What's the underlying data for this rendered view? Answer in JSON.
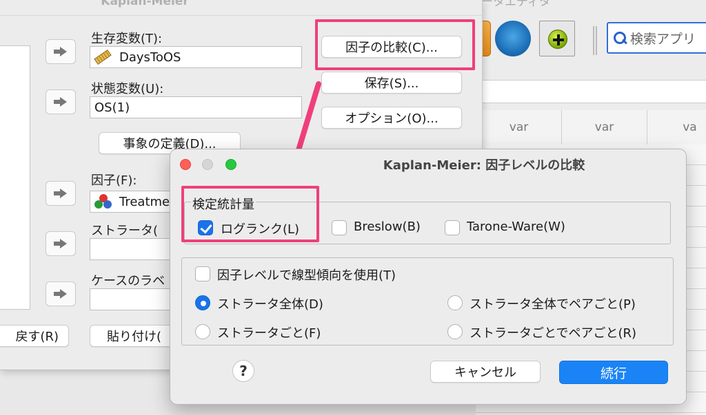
{
  "background_app": {
    "title": "ータエディタ",
    "search_placeholder": "検索アプリ",
    "column_headers": [
      "",
      "var",
      "var",
      "va"
    ]
  },
  "main_dialog": {
    "title": "Kaplan-Meier",
    "survival_label": "生存変数(T):",
    "survival_value": "DaysToOS",
    "status_label": "状態変数(U):",
    "status_value": "OS(1)",
    "define_event_button": "事象の定義(D)...",
    "factor_label": "因子(F):",
    "factor_value": "Treatme",
    "strata_label": "ストラータ(",
    "case_label_label": "ケースのラベ",
    "compare_factor_button": "因子の比較(C)...",
    "save_button": "保存(S)...",
    "options_button": "オプション(O)...",
    "reset_button": "戻す(R)",
    "paste_button": "貼り付け("
  },
  "sub_dialog": {
    "title": "Kaplan-Meier: 因子レベルの比較",
    "test_statistics_legend": "検定統計量",
    "logrank_label": "ログランク(L)",
    "breslow_label": "Breslow(B)",
    "tarone_label": "Tarone-Ware(W)",
    "linear_trend_label": "因子レベルで線型傾向を使用(T)",
    "pooled_strata_label": "ストラータ全体(D)",
    "pairwise_pooled_label": "ストラータ全体でペアごと(P)",
    "per_stratum_label": "ストラータごと(F)",
    "pairwise_per_stratum_label": "ストラータごとでペアごと(R)",
    "help_label": "?",
    "cancel_button": "キャンセル",
    "continue_button": "続行",
    "logrank_checked": true,
    "breslow_checked": false,
    "tarone_checked": false,
    "linear_trend_checked": false,
    "selected_option": "pooled_strata"
  },
  "colors": {
    "highlight": "#ef3f7d",
    "accent_blue": "#1a84f6"
  }
}
